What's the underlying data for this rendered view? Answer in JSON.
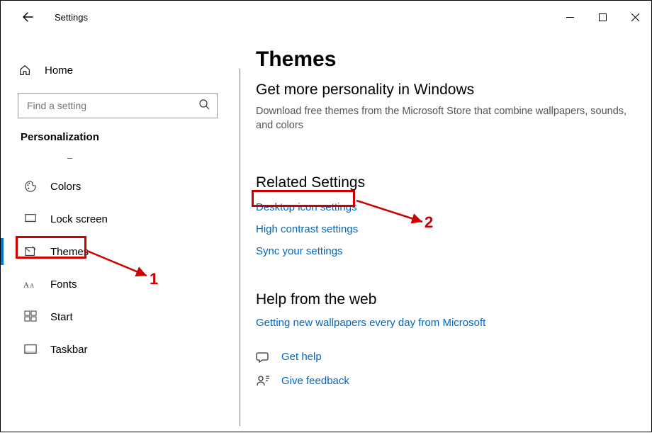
{
  "window": {
    "app_title": "Settings"
  },
  "sidebar": {
    "home_label": "Home",
    "search_placeholder": "Find a setting",
    "section_label": "Personalization",
    "items": [
      {
        "label": "Colors"
      },
      {
        "label": "Lock screen"
      },
      {
        "label": "Themes"
      },
      {
        "label": "Fonts"
      },
      {
        "label": "Start"
      },
      {
        "label": "Taskbar"
      }
    ]
  },
  "main": {
    "title": "Themes",
    "subhead": "Get more personality in Windows",
    "desc": "Download free themes from the Microsoft Store that combine wallpapers, sounds, and colors",
    "related_title": "Related Settings",
    "related_links": [
      "Desktop icon settings",
      "High contrast settings",
      "Sync your settings"
    ],
    "help_title": "Help from the web",
    "help_links": [
      "Getting new wallpapers every day from Microsoft"
    ],
    "footer": {
      "get_help": "Get help",
      "feedback": "Give feedback"
    }
  },
  "annotations": {
    "label1": "1",
    "label2": "2"
  }
}
